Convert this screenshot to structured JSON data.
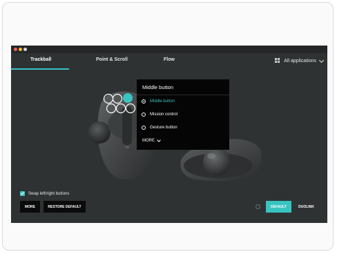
{
  "tabs": [
    {
      "label": "Trackball",
      "active": true
    },
    {
      "label": "Point & Scroll",
      "active": false
    },
    {
      "label": "Flow",
      "active": false
    }
  ],
  "apps_selector": {
    "label": "All applications"
  },
  "popover": {
    "title": "Middle button",
    "options": [
      {
        "label": "Middle button",
        "selected": true
      },
      {
        "label": "Mission control",
        "selected": false
      },
      {
        "label": "Gesture button",
        "selected": false
      }
    ],
    "more_label": "MORE"
  },
  "swap_checkbox": {
    "label": "Swap left/right buttons",
    "checked": true
  },
  "buttons": {
    "more": "MORE",
    "restore": "RESTORE DEFAULT",
    "default": "DEFAULT",
    "duolink": "DUOLINK"
  },
  "colors": {
    "accent": "#38c4c0",
    "app_bg": "#2f3233",
    "popover_bg": "#050505"
  },
  "icons": [
    "grid-icon",
    "chevron-down-icon",
    "trackball-mouse-icon"
  ]
}
